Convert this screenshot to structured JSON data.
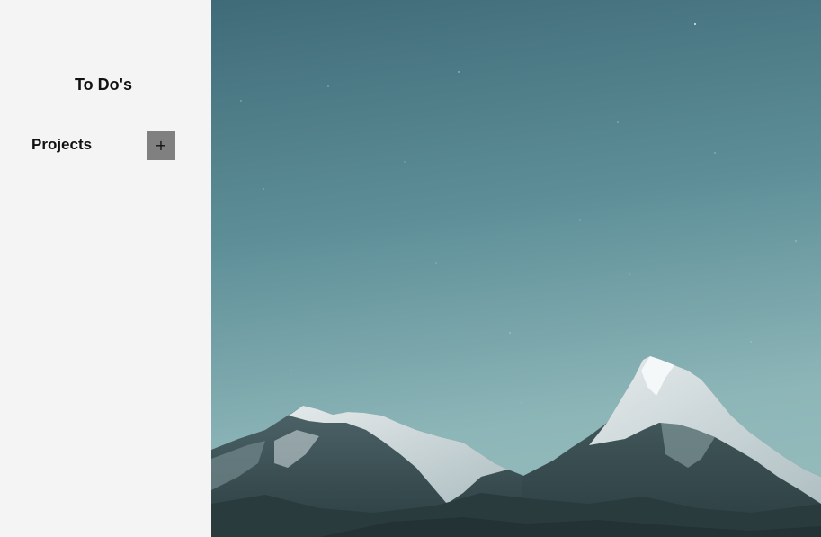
{
  "sidebar": {
    "title": "To Do's",
    "projects_label": "Projects",
    "add_project_glyph": "+",
    "add_project_icon": "plus-icon"
  },
  "colors": {
    "sidebar_bg": "#f4f4f4",
    "add_button_bg": "#808080",
    "sky_top": "#3f6b78",
    "sky_bottom": "#8db6b8",
    "mountain_dark": "#2f4448",
    "snow": "#e4ecee"
  },
  "main": {
    "background_image": "mountain-landscape-image"
  }
}
